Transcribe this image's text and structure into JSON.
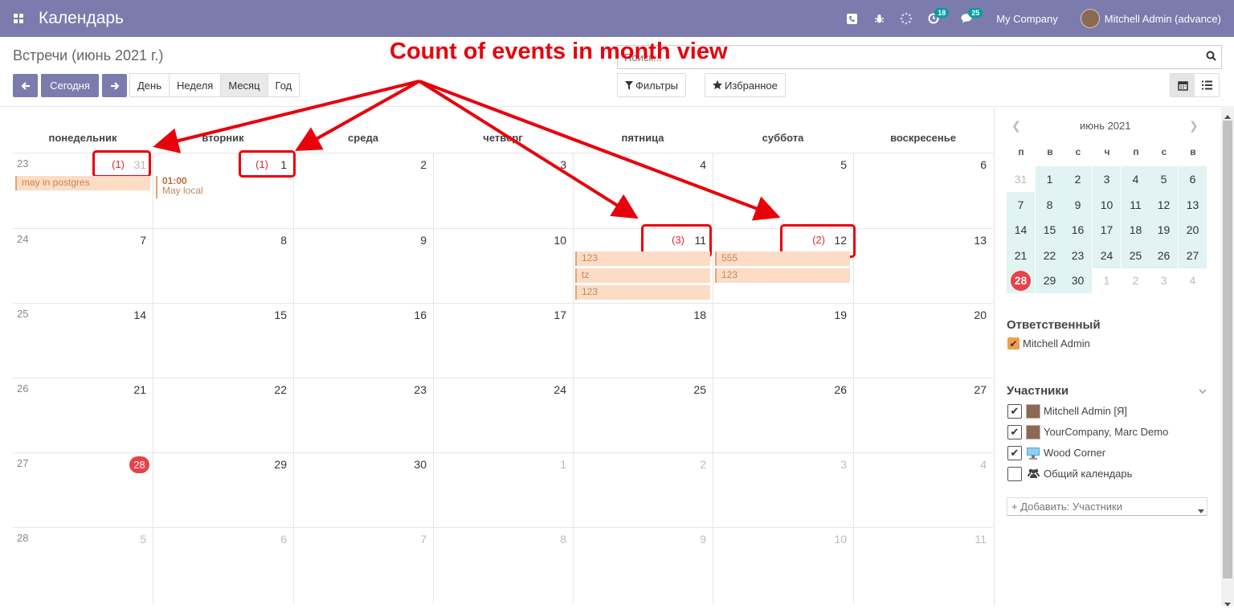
{
  "app": {
    "brand": "Календарь"
  },
  "navbar": {
    "badge_activities": "18",
    "badge_messages": "25",
    "company": "My Company",
    "user": "Mitchell Admin (advance)"
  },
  "control": {
    "breadcrumb": "Встречи (июнь 2021 г.)",
    "today": "Сегодня",
    "scales": [
      "День",
      "Неделя",
      "Месяц",
      "Год"
    ],
    "search_placeholder": "Поиск...",
    "filters": "Фильтры",
    "favorites": "Избранное"
  },
  "annotation": {
    "text": "Count of events in month view"
  },
  "calendar": {
    "weekdays": [
      "понедельник",
      "вторник",
      "среда",
      "четверг",
      "пятница",
      "суббота",
      "воскресенье"
    ],
    "weeks": [
      {
        "week": "23",
        "days": [
          "31",
          "1",
          "2",
          "3",
          "4",
          "5",
          "6"
        ],
        "other": [
          true,
          false,
          false,
          false,
          false,
          false,
          false
        ]
      },
      {
        "week": "24",
        "days": [
          "7",
          "8",
          "9",
          "10",
          "11",
          "12",
          "13"
        ],
        "other": [
          false,
          false,
          false,
          false,
          false,
          false,
          false
        ]
      },
      {
        "week": "25",
        "days": [
          "14",
          "15",
          "16",
          "17",
          "18",
          "19",
          "20"
        ],
        "other": [
          false,
          false,
          false,
          false,
          false,
          false,
          false
        ]
      },
      {
        "week": "26",
        "days": [
          "21",
          "22",
          "23",
          "24",
          "25",
          "26",
          "27"
        ],
        "other": [
          false,
          false,
          false,
          false,
          false,
          false,
          false
        ]
      },
      {
        "week": "27",
        "days": [
          "28",
          "29",
          "30",
          "1",
          "2",
          "3",
          "4"
        ],
        "other": [
          false,
          false,
          false,
          true,
          true,
          true,
          true
        ]
      },
      {
        "week": "28",
        "days": [
          "5",
          "6",
          "7",
          "8",
          "9",
          "10",
          "11"
        ],
        "other": [
          true,
          true,
          true,
          true,
          true,
          true,
          true
        ]
      }
    ],
    "counts": {
      "w0d0": "(1)",
      "w0d1": "(1)",
      "w1d4": "(3)",
      "w1d5": "(2)"
    },
    "events": {
      "w0d0": "may in postgres",
      "w0d1_time": "01:00",
      "w0d1_title": "May local",
      "w1d4": [
        "123",
        "tz",
        "123"
      ],
      "w1d5": [
        "555",
        "123"
      ]
    }
  },
  "sidebar": {
    "mini_title": "июнь 2021",
    "mini_heads": [
      "п",
      "в",
      "с",
      "ч",
      "п",
      "с",
      "в"
    ],
    "mini_rows": [
      [
        "31",
        "1",
        "2",
        "3",
        "4",
        "5",
        "6"
      ],
      [
        "7",
        "8",
        "9",
        "10",
        "11",
        "12",
        "13"
      ],
      [
        "14",
        "15",
        "16",
        "17",
        "18",
        "19",
        "20"
      ],
      [
        "21",
        "22",
        "23",
        "24",
        "25",
        "26",
        "27"
      ],
      [
        "28",
        "29",
        "30",
        "1",
        "2",
        "3",
        "4"
      ]
    ],
    "responsible_title": "Ответственный",
    "responsible_name": "Mitchell Admin",
    "attendees_title": "Участники",
    "attendees": [
      "Mitchell Admin [Я]",
      "YourCompany, Marc Demo",
      "Wood Corner",
      "Общий календарь"
    ],
    "add_attendee": "+ Добавить: Участники"
  }
}
